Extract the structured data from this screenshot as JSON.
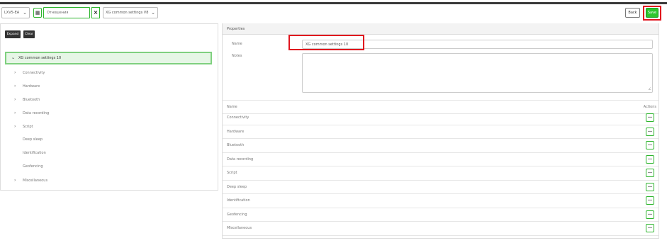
{
  "toolbar": {
    "device_select": "LXV5-EA",
    "search_text": "Отношения",
    "config_select": "XG common settings V8",
    "back_label": "Back",
    "save_label": "Save"
  },
  "tree": {
    "expand_label": "Expand",
    "clear_label": "Clear",
    "root_label": "XG common settings 10",
    "items": [
      {
        "label": "Connectivity",
        "expandable": true
      },
      {
        "label": "Hardware",
        "expandable": true
      },
      {
        "label": "Bluetooth",
        "expandable": true
      },
      {
        "label": "Data recording",
        "expandable": true
      },
      {
        "label": "Script",
        "expandable": true
      },
      {
        "label": "Deep sleep",
        "expandable": false
      },
      {
        "label": "Identification",
        "expandable": false
      },
      {
        "label": "Geofencing",
        "expandable": false
      },
      {
        "label": "Miscellaneous",
        "expandable": true
      }
    ]
  },
  "properties": {
    "header": "Properties",
    "name_label": "Name",
    "name_value": "XG common settings 10",
    "notes_label": "Notes",
    "notes_value": "",
    "table": {
      "col_name": "Name",
      "col_actions": "Actions",
      "rows": [
        "Connectivity",
        "Hardware",
        "Bluetooth",
        "Data recording",
        "Script",
        "Deep sleep",
        "Identification",
        "Geofencing",
        "Miscellaneous"
      ]
    }
  },
  "icons": {
    "dropdown": "chevron-down-icon",
    "grid": "grid-icon",
    "clear": "close-icon",
    "tree_expand": "chevron-right-icon",
    "tree_collapse": "chevron-down-icon",
    "row_actions": "more-icon"
  },
  "colors": {
    "accent_green": "#2ec62e",
    "highlight_red": "#e0141e",
    "tree_selected_bg": "#e6f6e6"
  }
}
